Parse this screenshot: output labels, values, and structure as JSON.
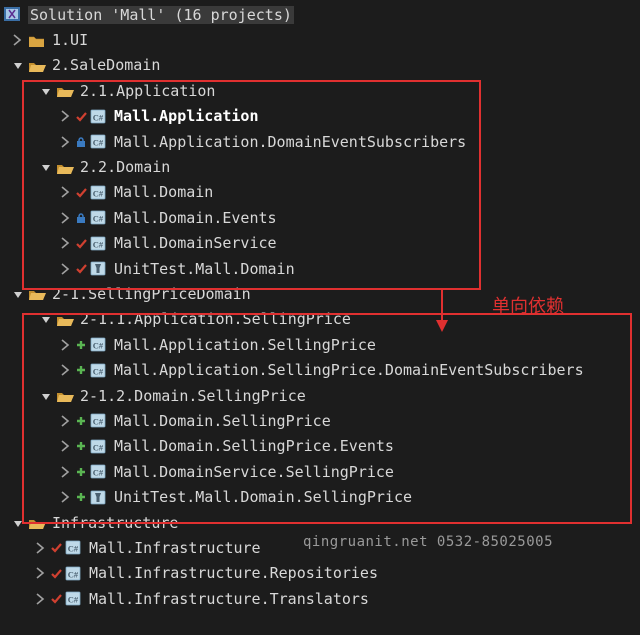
{
  "solution": {
    "title": "Solution 'Mall' (16 projects)"
  },
  "nodes": {
    "ui": "1.UI",
    "sale": "2.SaleDomain",
    "app21": "2.1.Application",
    "mallApp": "Mall.Application",
    "mallAppSubs": "Mall.Application.DomainEventSubscribers",
    "dom22": "2.2.Domain",
    "mallDomain": "Mall.Domain",
    "mallDomainEvents": "Mall.Domain.Events",
    "mallDomainService": "Mall.DomainService",
    "unitTestDomain": "UnitTest.Mall.Domain",
    "selling": "2-1.SellingPriceDomain",
    "sp211": "2-1.1.Application.SellingPrice",
    "spApp": "Mall.Application.SellingPrice",
    "spAppSubs": "Mall.Application.SellingPrice.DomainEventSubscribers",
    "sp212": "2-1.2.Domain.SellingPrice",
    "spDomain": "Mall.Domain.SellingPrice",
    "spDomainEvents": "Mall.Domain.SellingPrice.Events",
    "spDomainService": "Mall.DomainService.SellingPrice",
    "spUnitTest": "UnitTest.Mall.Domain.SellingPrice",
    "infra": "Infrastructure",
    "mallInfra": "Mall.Infrastructure",
    "mallInfraRepo": "Mall.Infrastructure.Repositories",
    "mallInfraTrans": "Mall.Infrastructure.Translators"
  },
  "annotation": {
    "text": "单向依赖"
  },
  "watermark": {
    "text": "qingruanit.net 0532-85025005"
  },
  "colors": {
    "bg": "#1C1C1C",
    "text": "#D8D8D8",
    "red": "#E03030",
    "folder": "#D9A441",
    "folderOpen": "#D9A441",
    "green": "#5AB552",
    "pale": "#BFD9E8"
  }
}
